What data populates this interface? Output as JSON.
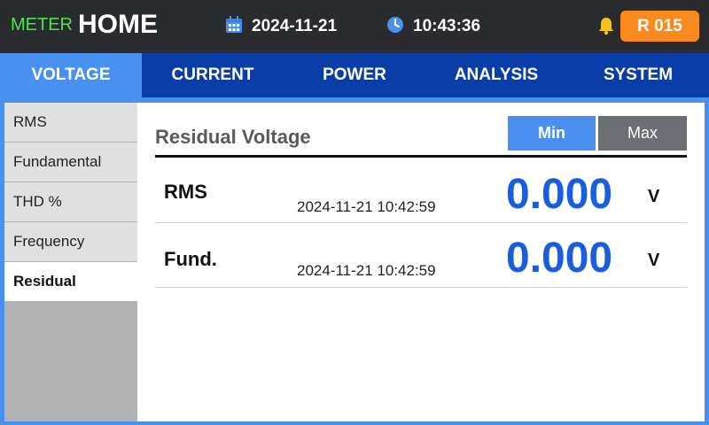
{
  "header": {
    "brand_small": "METER",
    "brand_title": "HOME",
    "date": "2024-11-21",
    "time": "10:43:36",
    "alarm_label": "R 015",
    "date_icon": "calendar-icon",
    "time_icon": "clock-icon",
    "alarm_icon": "bell-icon"
  },
  "tabs": [
    {
      "label": "VOLTAGE",
      "active": true
    },
    {
      "label": "CURRENT",
      "active": false
    },
    {
      "label": "POWER",
      "active": false
    },
    {
      "label": "ANALYSIS",
      "active": false
    },
    {
      "label": "SYSTEM",
      "active": false
    }
  ],
  "sidebar": {
    "items": [
      {
        "label": "RMS",
        "active": false
      },
      {
        "label": "Fundamental",
        "active": false
      },
      {
        "label": "THD %",
        "active": false
      },
      {
        "label": "Frequency",
        "active": false
      },
      {
        "label": "Residual",
        "active": true
      }
    ]
  },
  "main": {
    "title": "Residual Voltage",
    "toggle": {
      "min_label": "Min",
      "max_label": "Max",
      "selected": "Min"
    },
    "rows": [
      {
        "label": "RMS",
        "timestamp": "2024-11-21 10:42:59",
        "value": "0.000",
        "unit": "V"
      },
      {
        "label": "Fund.",
        "timestamp": "2024-11-21 10:42:59",
        "value": "0.000",
        "unit": "V"
      }
    ]
  },
  "colors": {
    "brand_green": "#4de34d",
    "tab_bar": "#0b3da8",
    "accent_blue": "#4a90f0",
    "value_blue": "#1a5ee0",
    "alarm_orange": "#f88a1e"
  }
}
